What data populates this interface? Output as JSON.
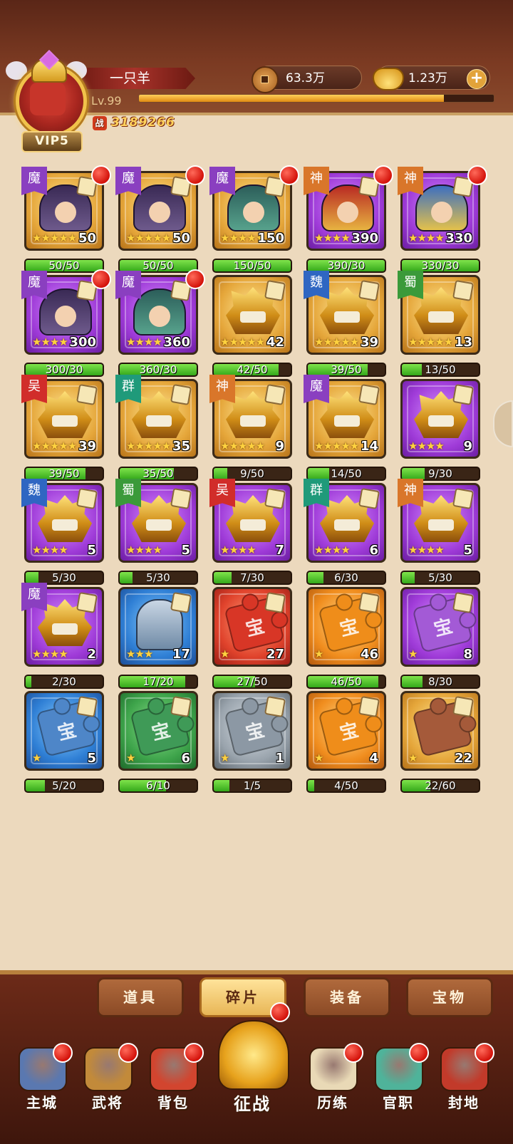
{
  "player": {
    "name": "一只羊",
    "vip": "VIP5",
    "level": "Lv.99",
    "level_progress": 0.86,
    "power": "3189266",
    "power_badge": "战"
  },
  "currency": {
    "coins": "63.3万",
    "ingots": "1.23万",
    "add_label": "+"
  },
  "items": [
    {
      "faction": "魔",
      "quality": "purple-gold",
      "art": "hero",
      "stars": "★★★★★",
      "count": "50",
      "progress": "50/50",
      "ratio": 1,
      "red_dot": true
    },
    {
      "faction": "魔",
      "quality": "gold",
      "art": "hero",
      "stars": "★★★★★",
      "count": "50",
      "progress": "50/50",
      "ratio": 1,
      "red_dot": true
    },
    {
      "faction": "魔",
      "quality": "gold",
      "art": "hero-green",
      "stars": "★★★★★",
      "count": "150",
      "progress": "150/50",
      "ratio": 1,
      "red_dot": true
    },
    {
      "faction": "神",
      "quality": "purple",
      "art": "hero-red",
      "stars": "★★★★",
      "count": "390",
      "progress": "390/30",
      "ratio": 1,
      "red_dot": true
    },
    {
      "faction": "神",
      "quality": "purple",
      "art": "hero-blue",
      "stars": "★★★★",
      "count": "330",
      "progress": "330/30",
      "ratio": 1,
      "red_dot": true
    },
    {
      "faction": "魔",
      "quality": "purple",
      "art": "hero",
      "stars": "★★★★",
      "count": "300",
      "progress": "300/30",
      "ratio": 1,
      "red_dot": true
    },
    {
      "faction": "魔",
      "quality": "purple",
      "art": "hero-green",
      "stars": "★★★★",
      "count": "360",
      "progress": "360/30",
      "ratio": 1,
      "red_dot": true
    },
    {
      "faction": "",
      "quality": "gold",
      "art": "helm",
      "stars": "★★★★★",
      "count": "42",
      "progress": "42/50",
      "ratio": 0.84,
      "red_dot": false
    },
    {
      "faction": "魏",
      "quality": "gold",
      "art": "helm",
      "stars": "★★★★★",
      "count": "39",
      "progress": "39/50",
      "ratio": 0.78,
      "red_dot": false
    },
    {
      "faction": "蜀",
      "quality": "gold",
      "art": "helm",
      "stars": "★★★★★",
      "count": "13",
      "progress": "13/50",
      "ratio": 0.26,
      "red_dot": false
    },
    {
      "faction": "吴",
      "quality": "gold",
      "art": "helm",
      "stars": "★★★★★",
      "count": "39",
      "progress": "39/50",
      "ratio": 0.78,
      "red_dot": false
    },
    {
      "faction": "群",
      "quality": "gold",
      "art": "helm",
      "stars": "★★★★★",
      "count": "35",
      "progress": "35/50",
      "ratio": 0.7,
      "red_dot": false
    },
    {
      "faction": "神",
      "quality": "gold",
      "art": "helm",
      "stars": "★★★★★",
      "count": "9",
      "progress": "9/50",
      "ratio": 0.18,
      "red_dot": false
    },
    {
      "faction": "魔",
      "quality": "gold",
      "art": "helm",
      "stars": "★★★★★",
      "count": "14",
      "progress": "14/50",
      "ratio": 0.28,
      "red_dot": false
    },
    {
      "faction": "",
      "quality": "purple",
      "art": "helm",
      "stars": "★★★★",
      "count": "9",
      "progress": "9/30",
      "ratio": 0.3,
      "red_dot": false
    },
    {
      "faction": "魏",
      "quality": "purple",
      "art": "helm",
      "stars": "★★★★",
      "count": "5",
      "progress": "5/30",
      "ratio": 0.17,
      "red_dot": false
    },
    {
      "faction": "蜀",
      "quality": "purple",
      "art": "helm",
      "stars": "★★★★",
      "count": "5",
      "progress": "5/30",
      "ratio": 0.17,
      "red_dot": false
    },
    {
      "faction": "吴",
      "quality": "purple",
      "art": "helm",
      "stars": "★★★★",
      "count": "7",
      "progress": "7/30",
      "ratio": 0.23,
      "red_dot": false
    },
    {
      "faction": "群",
      "quality": "purple",
      "art": "helm",
      "stars": "★★★★",
      "count": "6",
      "progress": "6/30",
      "ratio": 0.2,
      "red_dot": false
    },
    {
      "faction": "神",
      "quality": "purple",
      "art": "helm",
      "stars": "★★★★",
      "count": "5",
      "progress": "5/30",
      "ratio": 0.17,
      "red_dot": false
    },
    {
      "faction": "魔",
      "quality": "purple",
      "art": "helm",
      "stars": "★★★★",
      "count": "2",
      "progress": "2/30",
      "ratio": 0.07,
      "red_dot": false
    },
    {
      "faction": "",
      "quality": "blue",
      "art": "armor",
      "stars": "★★★",
      "count": "17",
      "progress": "17/20",
      "ratio": 0.85,
      "red_dot": false
    },
    {
      "faction": "",
      "quality": "red",
      "art": "puzzle-red",
      "stars": "★",
      "count": "27",
      "progress": "27/50",
      "ratio": 0.54,
      "red_dot": false
    },
    {
      "faction": "",
      "quality": "orange",
      "art": "puzzle-orange",
      "stars": "★",
      "count": "46",
      "progress": "46/50",
      "ratio": 0.92,
      "red_dot": false
    },
    {
      "faction": "",
      "quality": "purple",
      "art": "puzzle-purple",
      "stars": "★",
      "count": "8",
      "progress": "8/30",
      "ratio": 0.27,
      "red_dot": false
    },
    {
      "faction": "",
      "quality": "blue",
      "art": "puzzle-blue",
      "stars": "★",
      "count": "5",
      "progress": "5/20",
      "ratio": 0.25,
      "red_dot": false
    },
    {
      "faction": "",
      "quality": "green",
      "art": "puzzle-green",
      "stars": "★",
      "count": "6",
      "progress": "6/10",
      "ratio": 0.6,
      "red_dot": false
    },
    {
      "faction": "",
      "quality": "grey",
      "art": "puzzle-grey",
      "stars": "★",
      "count": "1",
      "progress": "1/5",
      "ratio": 0.2,
      "red_dot": false
    },
    {
      "faction": "",
      "quality": "orange",
      "art": "puzzle-orange",
      "stars": "★",
      "count": "4",
      "progress": "4/50",
      "ratio": 0.08,
      "red_dot": false
    },
    {
      "faction": "",
      "quality": "gold",
      "art": "puzzle-brown",
      "stars": "★",
      "count": "22",
      "progress": "22/60",
      "ratio": 0.37,
      "red_dot": false
    }
  ],
  "tabs": [
    {
      "label": "道具",
      "active": false,
      "red_dot": false
    },
    {
      "label": "碎片",
      "active": true,
      "red_dot": true
    },
    {
      "label": "装备",
      "active": false,
      "red_dot": false
    },
    {
      "label": "宝物",
      "active": false,
      "red_dot": false
    }
  ],
  "nav": [
    {
      "label": "主城",
      "icon": "palace-icon",
      "color": "#5a78b0",
      "red_dot": true
    },
    {
      "label": "武将",
      "icon": "general-icon",
      "color": "#c28a3a",
      "red_dot": true
    },
    {
      "label": "背包",
      "icon": "bag-icon",
      "color": "#d2452f",
      "red_dot": true
    },
    {
      "label": "征战",
      "icon": "battle-icon",
      "color": "#e7a21c",
      "red_dot": false,
      "main": true
    },
    {
      "label": "历练",
      "icon": "scroll-icon",
      "color": "#e9d9b6",
      "red_dot": true
    },
    {
      "label": "官职",
      "icon": "jade-icon",
      "color": "#4fb39a",
      "red_dot": true
    },
    {
      "label": "封地",
      "icon": "gate-icon",
      "color": "#c23a2a",
      "red_dot": true
    }
  ],
  "puzzle_glyph": "宝"
}
